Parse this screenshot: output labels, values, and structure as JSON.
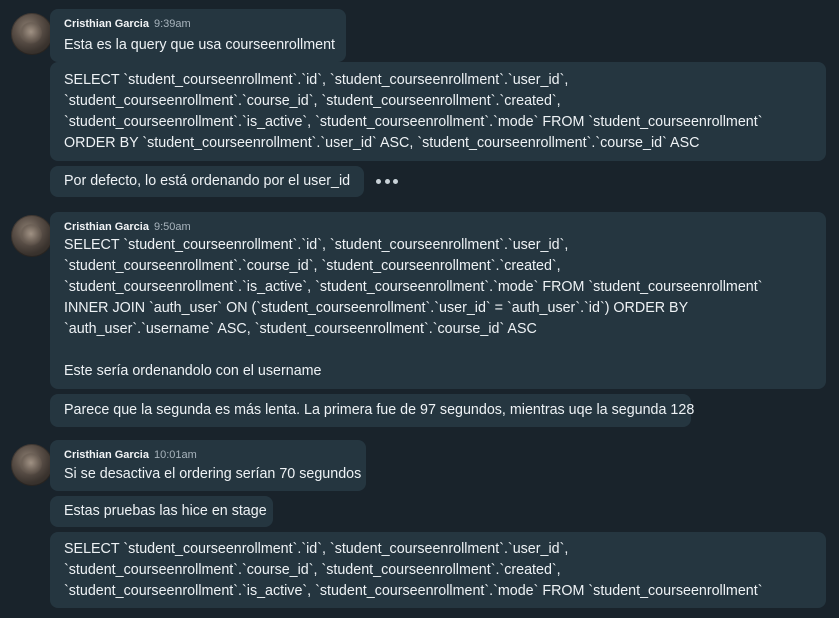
{
  "groups": [
    {
      "sender": "Cristhian Garcia",
      "time": "9:39am",
      "messages": [
        {
          "lines": [
            "Esta es la query que usa courseenrollment"
          ]
        },
        {
          "lines": [
            "SELECT `student_courseenrollment`.`id`, `student_courseenrollment`.`user_id`,",
            "`student_courseenrollment`.`course_id`, `student_courseenrollment`.`created`,",
            "`student_courseenrollment`.`is_active`, `student_courseenrollment`.`mode` FROM `student_courseenrollment`",
            "ORDER BY `student_courseenrollment`.`user_id` ASC, `student_courseenrollment`.`course_id` ASC"
          ]
        },
        {
          "lines": [
            "Por defecto, lo está ordenando por el user_id"
          ]
        }
      ]
    },
    {
      "sender": "Cristhian Garcia",
      "time": "9:50am",
      "messages": [
        {
          "lines": [
            "SELECT `student_courseenrollment`.`id`, `student_courseenrollment`.`user_id`,",
            "`student_courseenrollment`.`course_id`, `student_courseenrollment`.`created`,",
            "`student_courseenrollment`.`is_active`, `student_courseenrollment`.`mode` FROM `student_courseenrollment`",
            "INNER JOIN `auth_user` ON (`student_courseenrollment`.`user_id` = `auth_user`.`id`) ORDER BY",
            "`auth_user`.`username` ASC, `student_courseenrollment`.`course_id` ASC",
            "",
            "Este sería ordenandolo con el username"
          ]
        },
        {
          "lines": [
            "Parece que la segunda es más lenta. La primera fue de 97 segundos, mientras uqe la segunda 128"
          ]
        }
      ]
    },
    {
      "sender": "Cristhian Garcia",
      "time": "10:01am",
      "messages": [
        {
          "lines": [
            "Si se desactiva el ordering serían 70 segundos"
          ]
        },
        {
          "lines": [
            "Estas pruebas las hice en stage"
          ]
        },
        {
          "lines": [
            "SELECT `student_courseenrollment`.`id`, `student_courseenrollment`.`user_id`,",
            "`student_courseenrollment`.`course_id`, `student_courseenrollment`.`created`,",
            "`student_courseenrollment`.`is_active`, `student_courseenrollment`.`mode` FROM `student_courseenrollment`"
          ]
        }
      ]
    }
  ],
  "icons": {
    "more_actions": "more-horizontal-icon"
  },
  "colors": {
    "background": "#19232b",
    "bubble": "#253640",
    "text": "#eef2f5",
    "time": "#a7b3bc"
  }
}
